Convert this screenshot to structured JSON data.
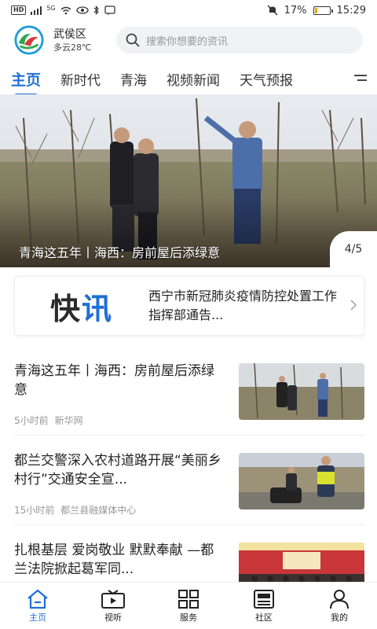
{
  "status_bar": {
    "network": "5G",
    "battery_percent": "17%",
    "battery_level": 0.17,
    "time": "15:29"
  },
  "header": {
    "city": "武侯区",
    "weather": "多云28℃",
    "search_placeholder": "搜索你想要的资讯"
  },
  "tabs": [
    "主页",
    "新时代",
    "青海",
    "视频新闻",
    "天气预报"
  ],
  "banner": {
    "caption": "青海这五年丨海西：房前屋后添绿意",
    "page_indicator": "4/5"
  },
  "flash": {
    "label_a": "快",
    "label_b": "讯",
    "text": "西宁市新冠肺炎疫情防控处置工作指挥部通告..."
  },
  "news": [
    {
      "title": "青海这五年丨海西：房前屋后添绿意",
      "time": "5小时前",
      "source": "新华网"
    },
    {
      "title": "都兰交警深入农村道路开展“美丽乡村行”交通安全宣...",
      "time": "15小时前",
      "source": "都兰县融媒体中心"
    },
    {
      "title": "扎根基层  爱岗敬业  默默奉献 —都兰法院掀起葛军同...",
      "time": "",
      "source": ""
    }
  ],
  "bottom_nav": [
    {
      "label": "主页",
      "icon": "home-icon"
    },
    {
      "label": "视听",
      "icon": "video-icon"
    },
    {
      "label": "服务",
      "icon": "grid-icon"
    },
    {
      "label": "社区",
      "icon": "newspaper-icon"
    },
    {
      "label": "我的",
      "icon": "user-icon"
    }
  ],
  "colors": {
    "accent": "#1f6fd6",
    "battery": "#f0a500"
  }
}
